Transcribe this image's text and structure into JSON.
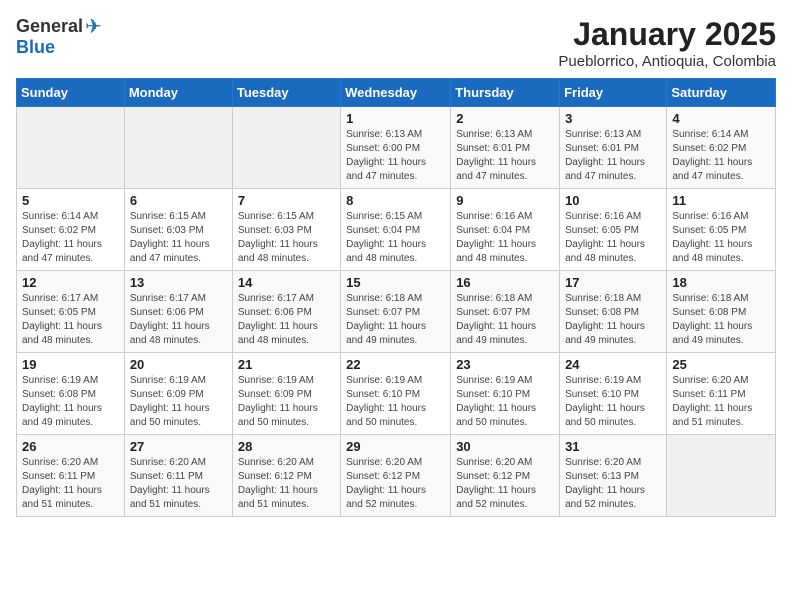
{
  "logo": {
    "general": "General",
    "blue": "Blue"
  },
  "header": {
    "month": "January 2025",
    "location": "Pueblorrico, Antioquia, Colombia"
  },
  "weekdays": [
    "Sunday",
    "Monday",
    "Tuesday",
    "Wednesday",
    "Thursday",
    "Friday",
    "Saturday"
  ],
  "weeks": [
    [
      {
        "day": "",
        "info": ""
      },
      {
        "day": "",
        "info": ""
      },
      {
        "day": "",
        "info": ""
      },
      {
        "day": "1",
        "info": "Sunrise: 6:13 AM\nSunset: 6:00 PM\nDaylight: 11 hours and 47 minutes."
      },
      {
        "day": "2",
        "info": "Sunrise: 6:13 AM\nSunset: 6:01 PM\nDaylight: 11 hours and 47 minutes."
      },
      {
        "day": "3",
        "info": "Sunrise: 6:13 AM\nSunset: 6:01 PM\nDaylight: 11 hours and 47 minutes."
      },
      {
        "day": "4",
        "info": "Sunrise: 6:14 AM\nSunset: 6:02 PM\nDaylight: 11 hours and 47 minutes."
      }
    ],
    [
      {
        "day": "5",
        "info": "Sunrise: 6:14 AM\nSunset: 6:02 PM\nDaylight: 11 hours and 47 minutes."
      },
      {
        "day": "6",
        "info": "Sunrise: 6:15 AM\nSunset: 6:03 PM\nDaylight: 11 hours and 47 minutes."
      },
      {
        "day": "7",
        "info": "Sunrise: 6:15 AM\nSunset: 6:03 PM\nDaylight: 11 hours and 48 minutes."
      },
      {
        "day": "8",
        "info": "Sunrise: 6:15 AM\nSunset: 6:04 PM\nDaylight: 11 hours and 48 minutes."
      },
      {
        "day": "9",
        "info": "Sunrise: 6:16 AM\nSunset: 6:04 PM\nDaylight: 11 hours and 48 minutes."
      },
      {
        "day": "10",
        "info": "Sunrise: 6:16 AM\nSunset: 6:05 PM\nDaylight: 11 hours and 48 minutes."
      },
      {
        "day": "11",
        "info": "Sunrise: 6:16 AM\nSunset: 6:05 PM\nDaylight: 11 hours and 48 minutes."
      }
    ],
    [
      {
        "day": "12",
        "info": "Sunrise: 6:17 AM\nSunset: 6:05 PM\nDaylight: 11 hours and 48 minutes."
      },
      {
        "day": "13",
        "info": "Sunrise: 6:17 AM\nSunset: 6:06 PM\nDaylight: 11 hours and 48 minutes."
      },
      {
        "day": "14",
        "info": "Sunrise: 6:17 AM\nSunset: 6:06 PM\nDaylight: 11 hours and 48 minutes."
      },
      {
        "day": "15",
        "info": "Sunrise: 6:18 AM\nSunset: 6:07 PM\nDaylight: 11 hours and 49 minutes."
      },
      {
        "day": "16",
        "info": "Sunrise: 6:18 AM\nSunset: 6:07 PM\nDaylight: 11 hours and 49 minutes."
      },
      {
        "day": "17",
        "info": "Sunrise: 6:18 AM\nSunset: 6:08 PM\nDaylight: 11 hours and 49 minutes."
      },
      {
        "day": "18",
        "info": "Sunrise: 6:18 AM\nSunset: 6:08 PM\nDaylight: 11 hours and 49 minutes."
      }
    ],
    [
      {
        "day": "19",
        "info": "Sunrise: 6:19 AM\nSunset: 6:08 PM\nDaylight: 11 hours and 49 minutes."
      },
      {
        "day": "20",
        "info": "Sunrise: 6:19 AM\nSunset: 6:09 PM\nDaylight: 11 hours and 50 minutes."
      },
      {
        "day": "21",
        "info": "Sunrise: 6:19 AM\nSunset: 6:09 PM\nDaylight: 11 hours and 50 minutes."
      },
      {
        "day": "22",
        "info": "Sunrise: 6:19 AM\nSunset: 6:10 PM\nDaylight: 11 hours and 50 minutes."
      },
      {
        "day": "23",
        "info": "Sunrise: 6:19 AM\nSunset: 6:10 PM\nDaylight: 11 hours and 50 minutes."
      },
      {
        "day": "24",
        "info": "Sunrise: 6:19 AM\nSunset: 6:10 PM\nDaylight: 11 hours and 50 minutes."
      },
      {
        "day": "25",
        "info": "Sunrise: 6:20 AM\nSunset: 6:11 PM\nDaylight: 11 hours and 51 minutes."
      }
    ],
    [
      {
        "day": "26",
        "info": "Sunrise: 6:20 AM\nSunset: 6:11 PM\nDaylight: 11 hours and 51 minutes."
      },
      {
        "day": "27",
        "info": "Sunrise: 6:20 AM\nSunset: 6:11 PM\nDaylight: 11 hours and 51 minutes."
      },
      {
        "day": "28",
        "info": "Sunrise: 6:20 AM\nSunset: 6:12 PM\nDaylight: 11 hours and 51 minutes."
      },
      {
        "day": "29",
        "info": "Sunrise: 6:20 AM\nSunset: 6:12 PM\nDaylight: 11 hours and 52 minutes."
      },
      {
        "day": "30",
        "info": "Sunrise: 6:20 AM\nSunset: 6:12 PM\nDaylight: 11 hours and 52 minutes."
      },
      {
        "day": "31",
        "info": "Sunrise: 6:20 AM\nSunset: 6:13 PM\nDaylight: 11 hours and 52 minutes."
      },
      {
        "day": "",
        "info": ""
      }
    ]
  ]
}
